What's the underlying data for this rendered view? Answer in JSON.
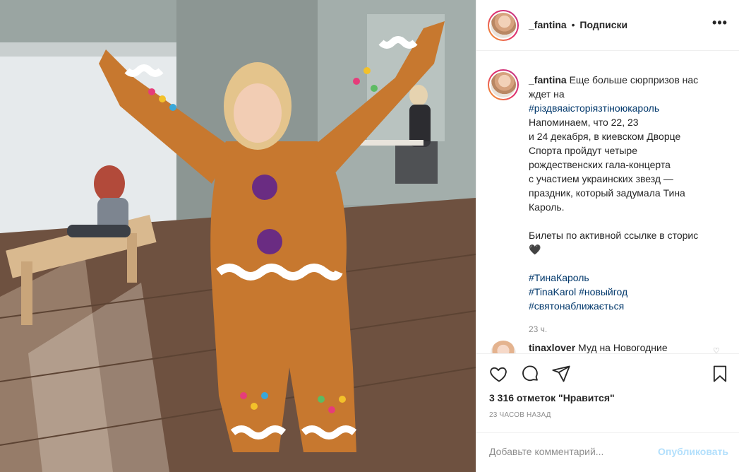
{
  "header": {
    "username": "_fantina",
    "separator": "•",
    "follow_label": "Подписки",
    "more_label": "•••"
  },
  "caption": {
    "username": "_fantina",
    "lines": [
      "Еще больше сюрпризов нас",
      "ждет на",
      "#різдвяаісторіязтіноюкароль",
      "Напоминаем, что 22, 23",
      "и 24 декабря, в киевском Дворце",
      "Спорта пройдут четыре",
      "рождественских гала-концерта",
      "с участием украинских звезд —",
      "праздник, который задумала Тина",
      "Кароль.",
      "",
      "Билеты по активной ссылке в сторис",
      "🖤",
      "",
      "#ТинаКароль",
      "#TinaKarol #новыйгод",
      "#святонаближається"
    ],
    "first_line_rest": "Еще больше сюрпризов нас",
    "time": "23 ч."
  },
  "comment2": {
    "username": "tinaxlover",
    "text": "Муд на Новогодние"
  },
  "actions": {
    "like_icon": "heart-outline-icon",
    "comment_icon": "comment-bubble-icon",
    "share_icon": "paper-plane-icon",
    "save_icon": "bookmark-icon"
  },
  "likes": "3 316 отметок \"Нравится\"",
  "post_time": "23 ЧАСОВ НАЗАД",
  "add_comment": {
    "placeholder": "Добавьте комментарий...",
    "publish_label": "Опубликовать"
  },
  "colors": {
    "link": "#00376b",
    "muted": "#8e8e8e",
    "publish_disabled": "#b2dffc",
    "costume": "#c7782f"
  }
}
